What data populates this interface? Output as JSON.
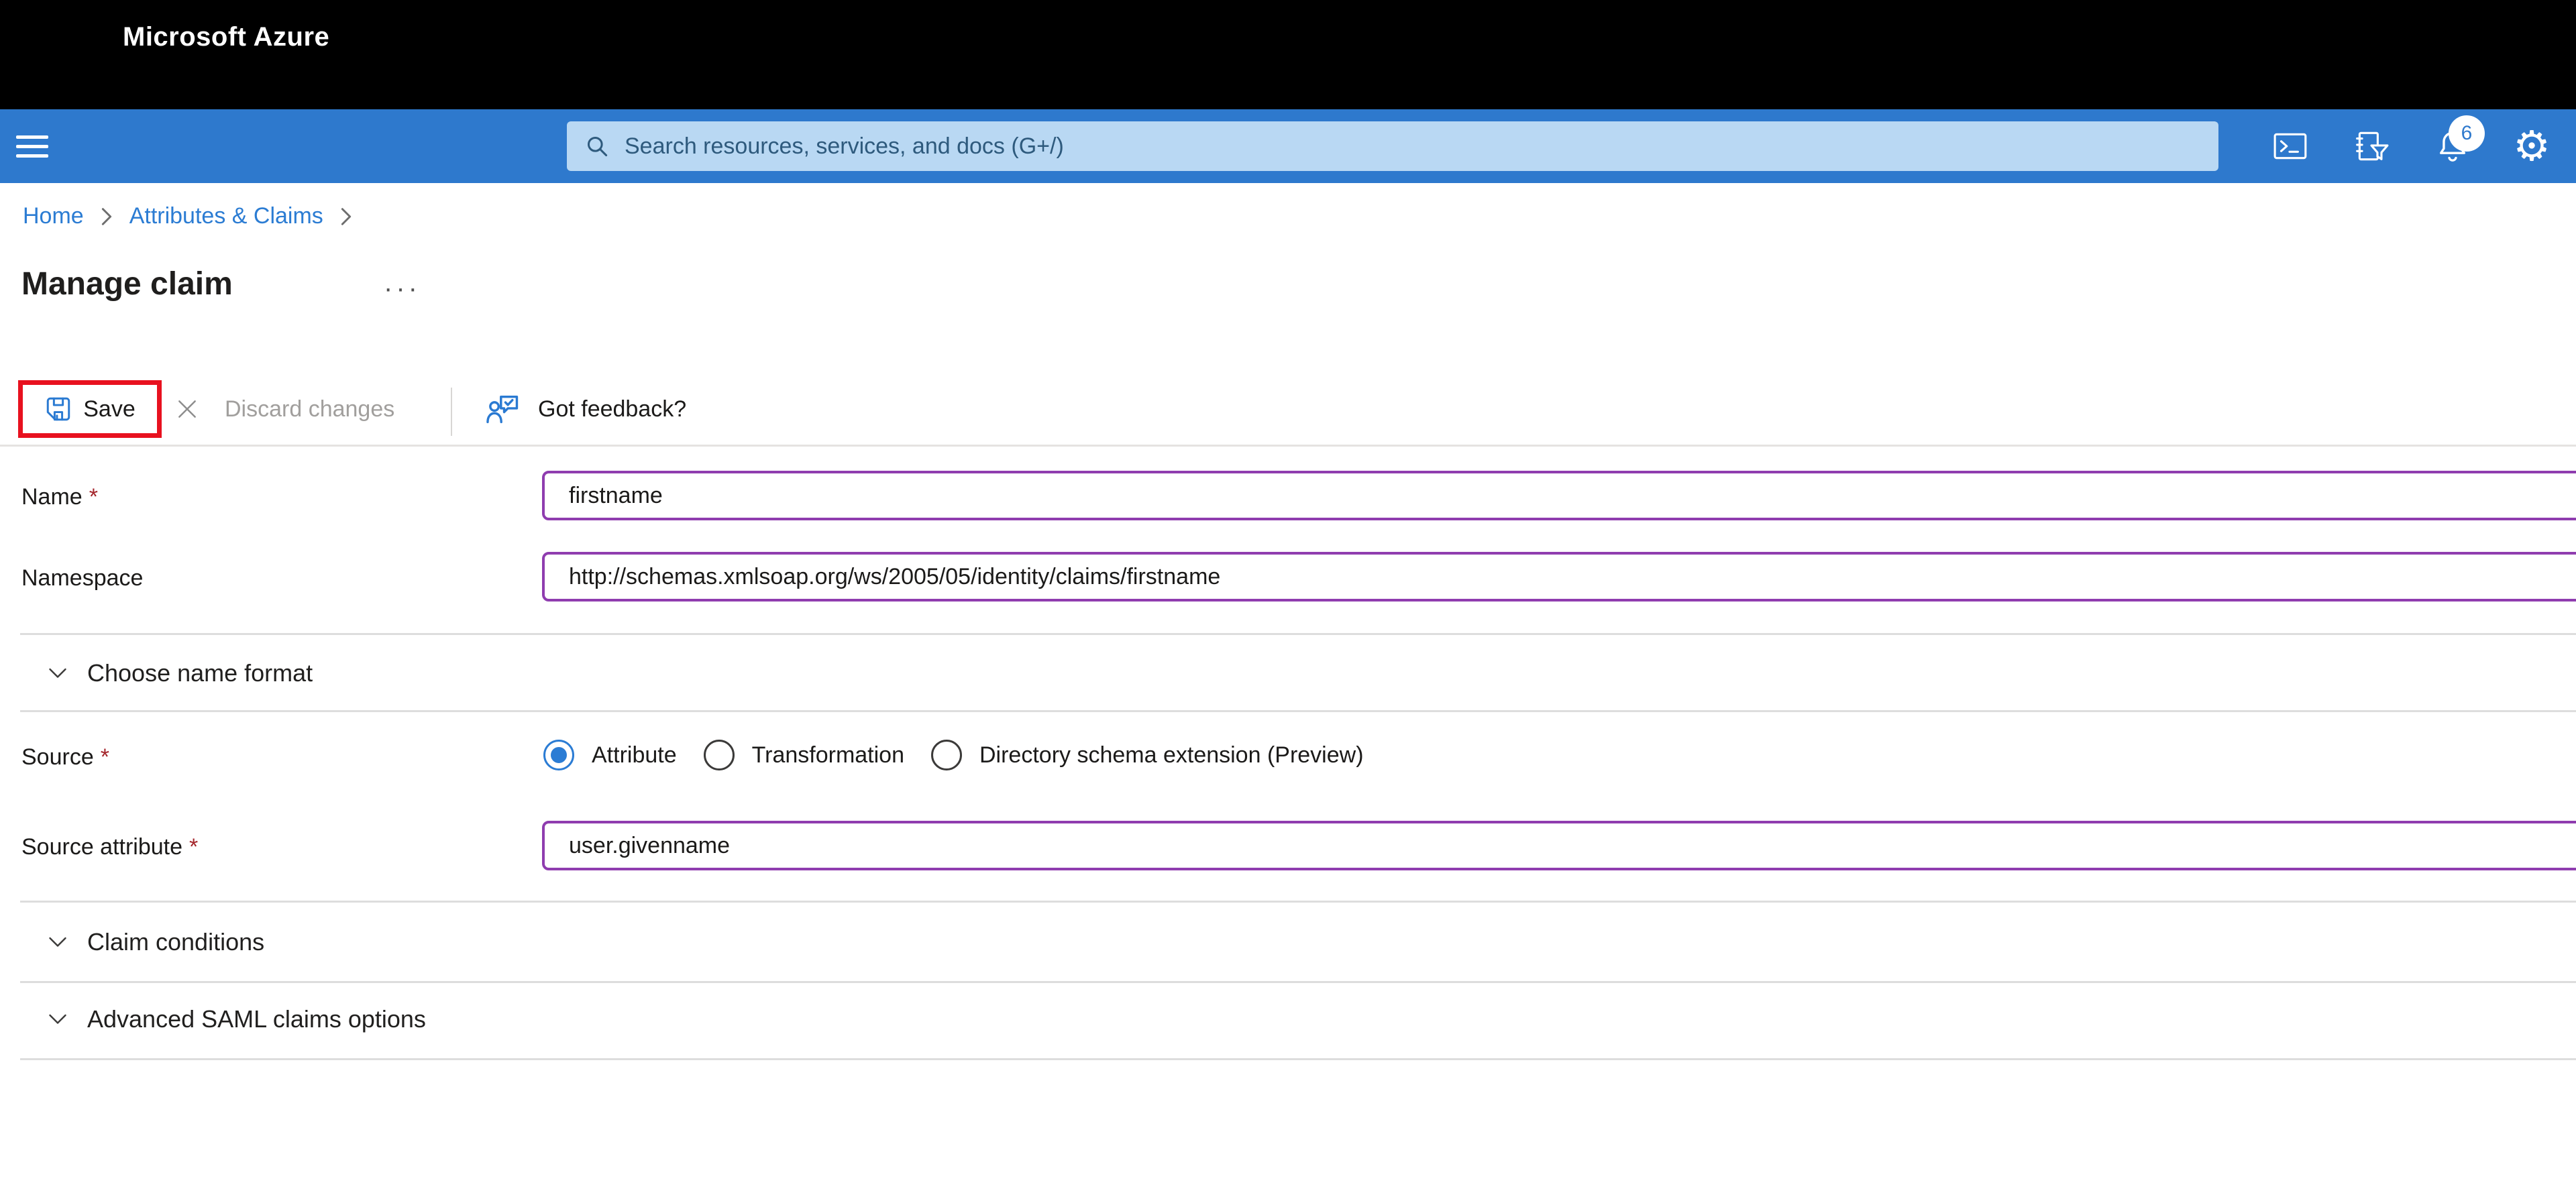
{
  "colors": {
    "headerBlue": "#2e79cd",
    "searchBg": "#b9d8f3",
    "searchText": "#2e5a7d",
    "linkBlue": "#2b7cd3",
    "accentRed": "#e8111f",
    "inputBorder": "#8f3daf",
    "iconBlue": "#2a7ad2",
    "radioBlue": "#2b7cd4",
    "disabledText": "#a19f9d",
    "requiredRed": "#a4262c"
  },
  "header": {
    "brand": "Microsoft Azure",
    "search_placeholder": "Search resources, services, and docs (G+/)",
    "notification_count": "6"
  },
  "breadcrumb": {
    "home": "Home",
    "parent": "Attributes & Claims"
  },
  "page": {
    "title": "Manage claim",
    "more": "···"
  },
  "toolbar": {
    "save": "Save",
    "discard": "Discard changes",
    "feedback": "Got feedback?"
  },
  "form": {
    "required_marker": "*",
    "name": {
      "label": "Name",
      "value": "firstname"
    },
    "namespace": {
      "label": "Namespace",
      "value": "http://schemas.xmlsoap.org/ws/2005/05/identity/claims/firstname"
    },
    "sections": {
      "name_format": "Choose name format",
      "claim_conditions": "Claim conditions",
      "advanced_saml": "Advanced SAML claims options"
    },
    "source": {
      "label": "Source",
      "options": [
        {
          "label": "Attribute",
          "selected": true
        },
        {
          "label": "Transformation",
          "selected": false
        },
        {
          "label": "Directory schema extension (Preview)",
          "selected": false
        }
      ]
    },
    "source_attribute": {
      "label": "Source attribute",
      "value": "user.givenname"
    }
  }
}
